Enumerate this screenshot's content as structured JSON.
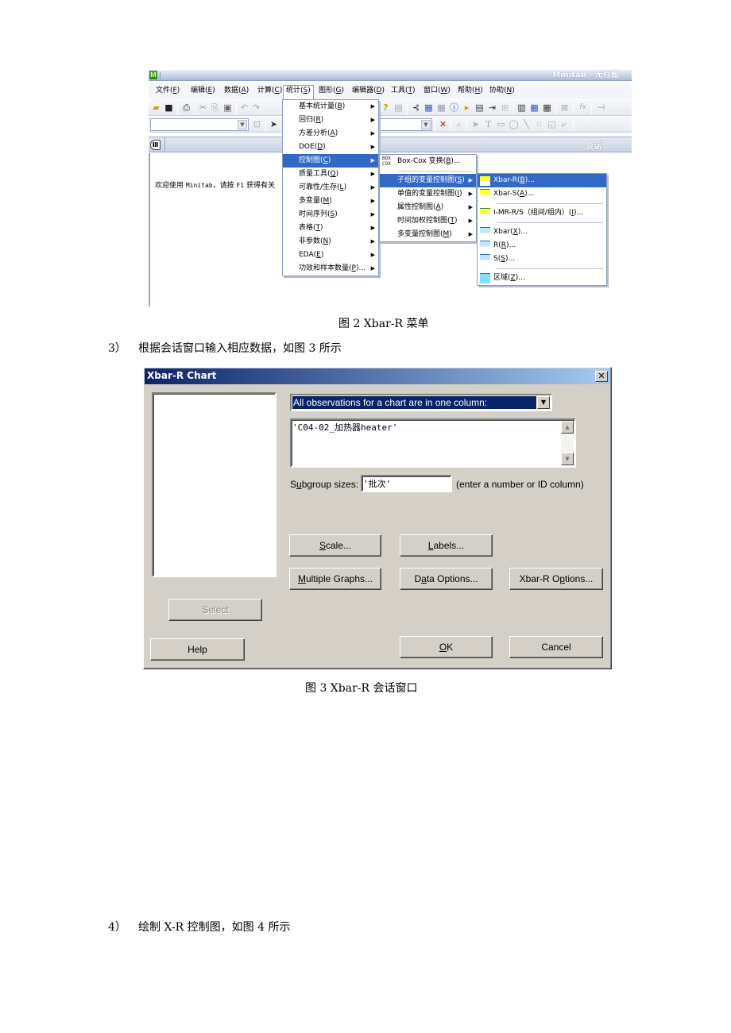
{
  "figure2": {
    "window_title": "Minitab - 无标题",
    "app_logo": "M",
    "menubar": [
      {
        "label": "文件(",
        "key": "F",
        "tail": ")"
      },
      {
        "label": "编辑(",
        "key": "E",
        "tail": ")"
      },
      {
        "label": "数据(",
        "key": "A",
        "tail": ")"
      },
      {
        "label": "计算(",
        "key": "C",
        "tail": ")"
      },
      {
        "label": "统计(",
        "key": "S",
        "tail": ")"
      },
      {
        "label": "图形(",
        "key": "G",
        "tail": ")"
      },
      {
        "label": "编辑器(",
        "key": "D",
        "tail": ")"
      },
      {
        "label": "工具(",
        "key": "T",
        "tail": ")"
      },
      {
        "label": "窗口(",
        "key": "W",
        "tail": ")"
      },
      {
        "label": "帮助(",
        "key": "H",
        "tail": ")"
      },
      {
        "label": "协助(",
        "key": "N",
        "tail": ")"
      }
    ],
    "toolbar_icons": [
      "open-icon",
      "save-icon",
      "print-icon",
      "cut-icon",
      "copy-icon",
      "paste-icon",
      "undo-icon",
      "redo-icon"
    ],
    "session_window_title": "会话",
    "welcome_text_1": "欢迎使用 ",
    "welcome_text_mono": "Minitab",
    "welcome_text_2": "，请按 ",
    "welcome_text_mono2": "F1",
    "welcome_text_3": " 获得有关",
    "stat_menu": [
      {
        "label": "基本统计量(",
        "key": "B",
        "tail": ")"
      },
      {
        "label": "回归(",
        "key": "R",
        "tail": ")"
      },
      {
        "label": "方差分析(",
        "key": "A",
        "tail": ")"
      },
      {
        "label": "DOE(",
        "key": "D",
        "tail": ")"
      },
      {
        "label": "控制图(",
        "key": "C",
        "tail": ")"
      },
      {
        "label": "质量工具(",
        "key": "Q",
        "tail": ")"
      },
      {
        "label": "可靠性/生存(",
        "key": "L",
        "tail": ")"
      },
      {
        "label": "多变量(",
        "key": "M",
        "tail": ")"
      },
      {
        "label": "时间序列(",
        "key": "S",
        "tail": ")"
      },
      {
        "label": "表格(",
        "key": "T",
        "tail": ")"
      },
      {
        "label": "非参数(",
        "key": "N",
        "tail": ")"
      },
      {
        "label": "EDA(",
        "key": "E",
        "tail": ")"
      },
      {
        "label": "功效和样本数量(",
        "key": "P",
        "tail": ")..."
      }
    ],
    "stat_menu_highlighted": "控制图(C)",
    "control_chart_menu": {
      "boxcox": {
        "icon": "BOX COX",
        "label": "Box-Cox 变换(",
        "key": "B",
        "tail": ")..."
      },
      "items": [
        {
          "label": "子组的变量控制图(",
          "key": "S",
          "tail": ")"
        },
        {
          "label": "单值的变量控制图(",
          "key": "I",
          "tail": ")"
        },
        {
          "label": "属性控制图(",
          "key": "A",
          "tail": ")"
        },
        {
          "label": "时间加权控制图(",
          "key": "T",
          "tail": ")"
        },
        {
          "label": "多变量控制图(",
          "key": "M",
          "tail": ")"
        }
      ]
    },
    "subgroup_menu": [
      {
        "label": "Xbar-R(",
        "key": "B",
        "tail": ")...",
        "icon": "xbar-r-chart-icon",
        "icon_text": "X̄R"
      },
      {
        "label": "Xbar-S(",
        "key": "A",
        "tail": ")...",
        "icon": "xbar-s-chart-icon",
        "icon_text": "X̄S"
      },
      {
        "label": "I-MR-R/S（组间/组内）(",
        "key": "I",
        "tail": ")...",
        "icon": "imrr-chart-icon",
        "icon_text": "IMRR"
      },
      {
        "label": "Xbar(",
        "key": "X",
        "tail": ")...",
        "icon": "xbar-chart-icon",
        "icon_text": "X̄"
      },
      {
        "label": "R(",
        "key": "R",
        "tail": ")...",
        "icon": "r-chart-icon",
        "icon_text": "R"
      },
      {
        "label": "S(",
        "key": "S",
        "tail": ")...",
        "icon": "s-chart-icon",
        "icon_text": "S"
      },
      {
        "label": "区域(",
        "key": "Z",
        "tail": ")...",
        "icon": "zone-chart-icon",
        "icon_text": "ZONE"
      }
    ],
    "caption": "图 2 Xbar-R 菜单"
  },
  "step3": {
    "number": "3）",
    "text": "根据会话窗口输入相应数据，如图 3 所示"
  },
  "figure3": {
    "dialog_title": "Xbar-R Chart",
    "close_label": "✕",
    "data_arrangement_selected": "All observations for a chart are in one column:",
    "variables_value": "'C04-02_加热器heater'",
    "subgroup_label_pre": "S",
    "subgroup_label_key": "u",
    "subgroup_label_post": "bgroup sizes:",
    "subgroup_value": "'批次'",
    "subgroup_hint": "(enter a number or ID column)",
    "buttons": {
      "scale": {
        "key": "S",
        "rest": "cale..."
      },
      "labels": {
        "key": "L",
        "rest": "abels..."
      },
      "multiple_graphs": {
        "key": "M",
        "rest": "ultiple Graphs..."
      },
      "data_options_pre": "D",
      "data_options_key": "a",
      "data_options_post": "ta Options...",
      "xbar_r_options_pre": "Xbar-R O",
      "xbar_r_options_key": "p",
      "xbar_r_options_post": "tions...",
      "select": "Select",
      "help": "Help",
      "ok": {
        "key": "O",
        "rest": "K"
      },
      "cancel": "Cancel"
    },
    "caption": "图 3   Xbar-R 会话窗口"
  },
  "step4": {
    "number": "4）",
    "text": "绘制 X-R 控制图，如图 4 所示"
  }
}
